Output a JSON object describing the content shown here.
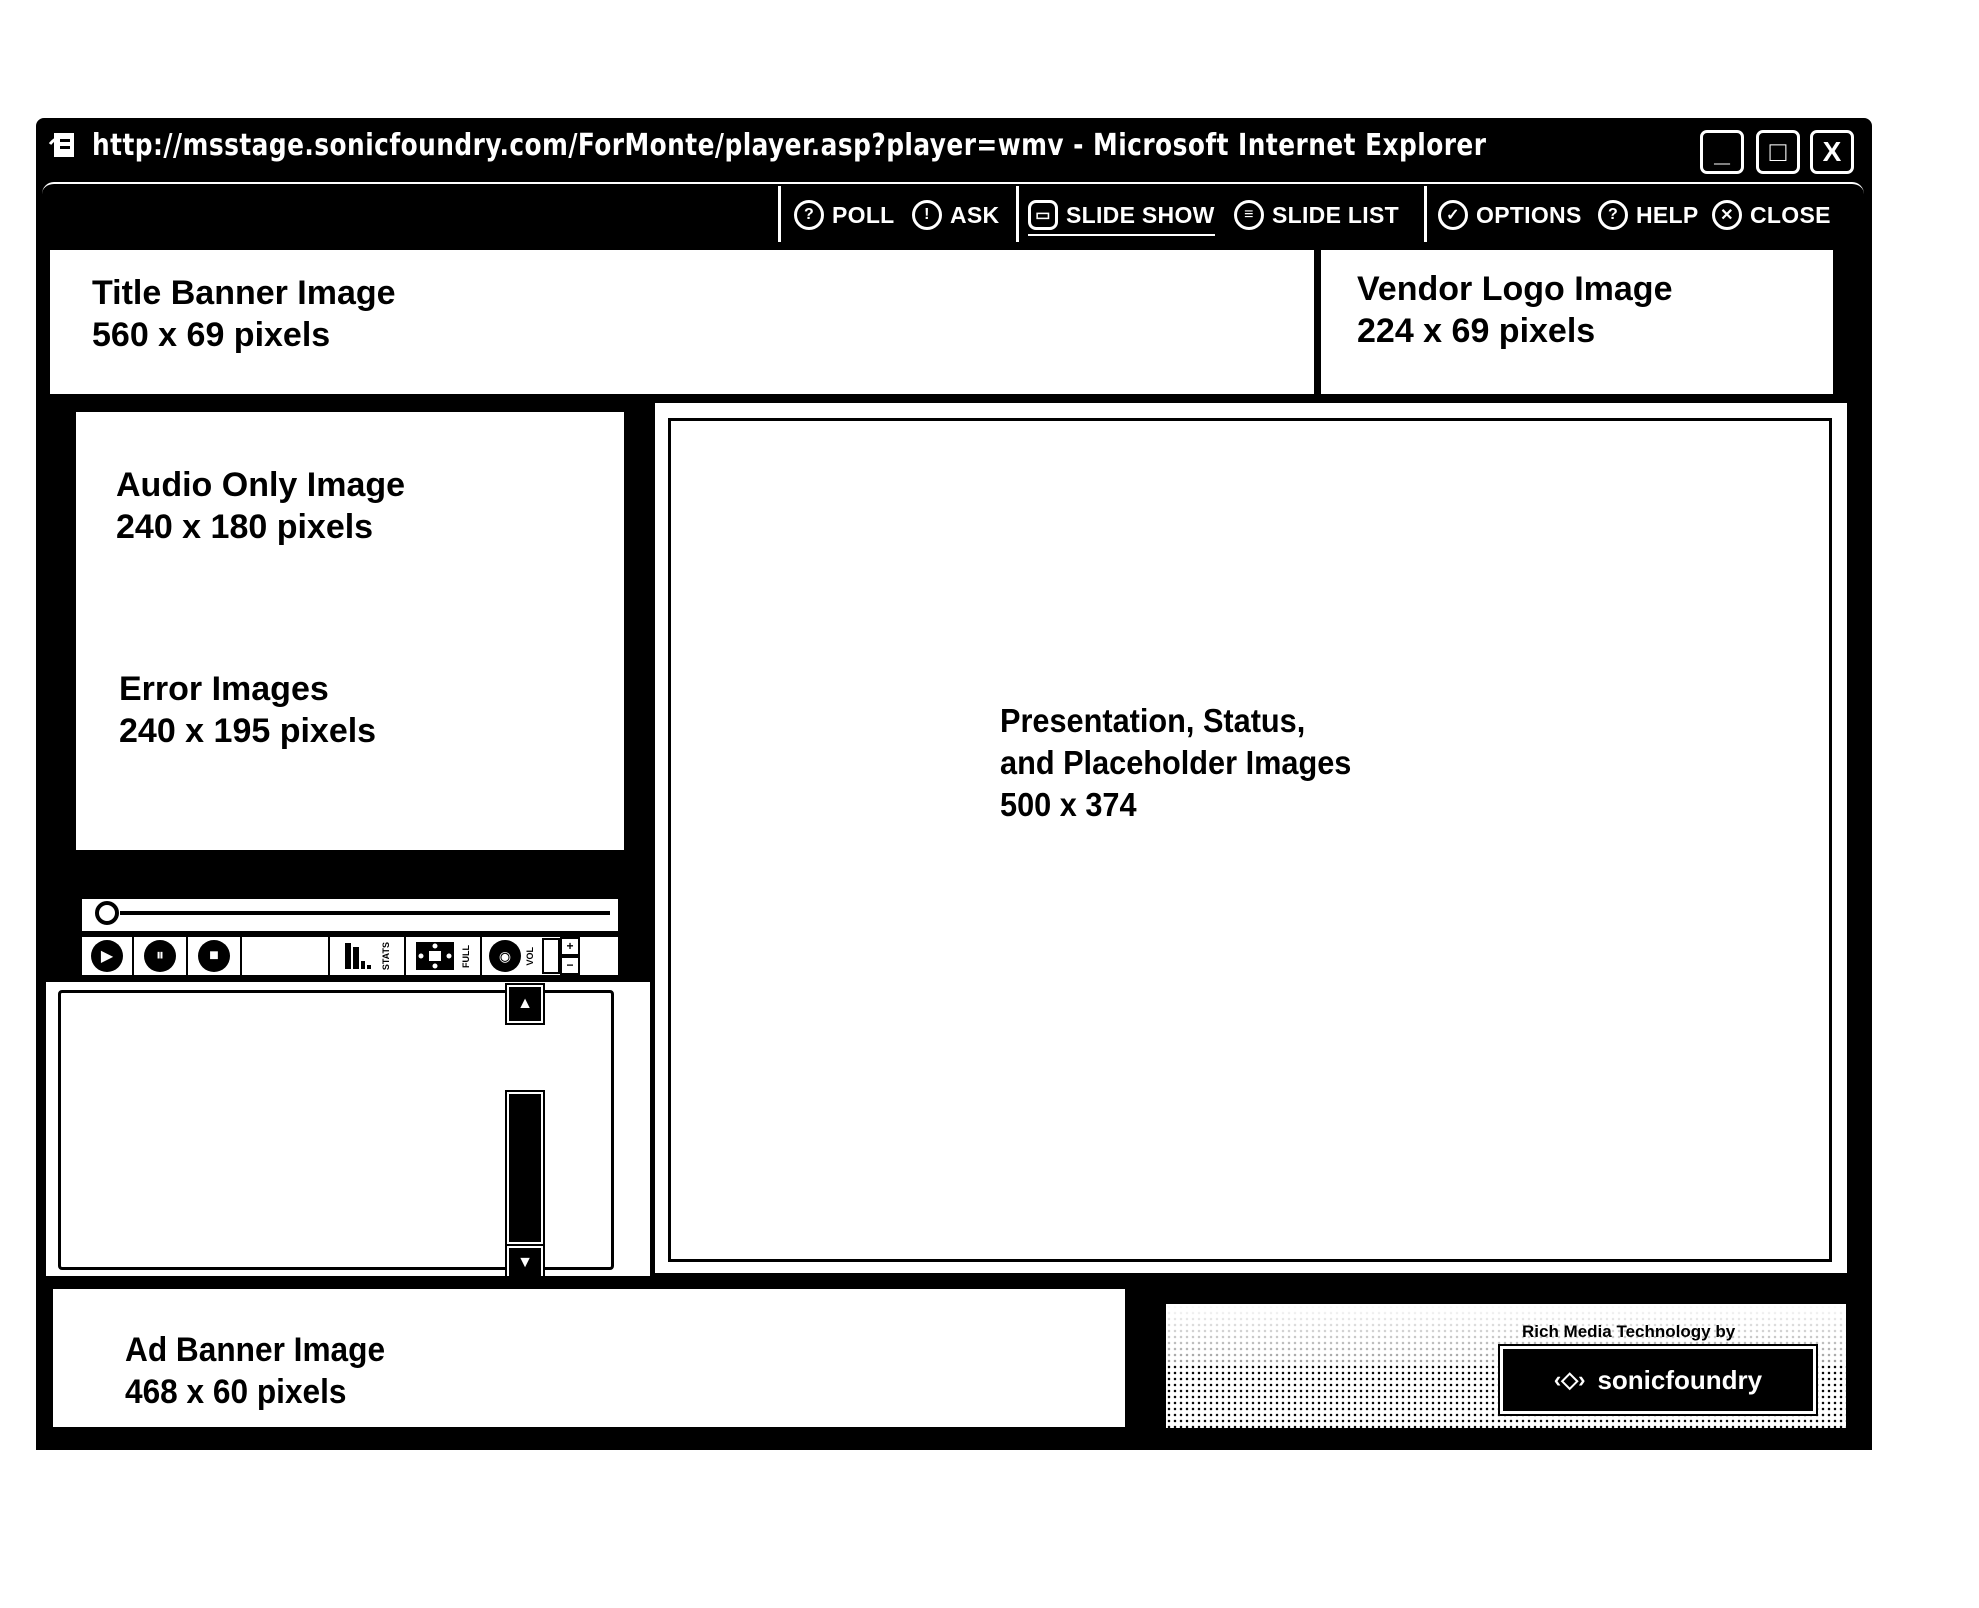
{
  "window": {
    "title": "http://msstage.sonicfoundry.com/ForMonte/player.asp?player=wmv - Microsoft Internet Explorer",
    "controls": {
      "minimize": "_",
      "maximize": "□",
      "close": "X"
    }
  },
  "toolbar": {
    "groups": [
      {
        "items": [
          {
            "label": "POLL",
            "icon": "poll-icon"
          },
          {
            "label": "ASK",
            "icon": "ask-icon"
          }
        ]
      },
      {
        "items": [
          {
            "label": "SLIDE SHOW",
            "icon": "slide-show-icon"
          },
          {
            "label": "SLIDE LIST",
            "icon": "slide-list-icon"
          }
        ]
      },
      {
        "items": [
          {
            "label": "OPTIONS",
            "icon": "options-icon"
          },
          {
            "label": "HELP",
            "icon": "help-icon"
          },
          {
            "label": "CLOSE",
            "icon": "close-icon"
          }
        ]
      }
    ]
  },
  "title_banner": {
    "name": "Title Banner Image",
    "size": "560 x 69 pixels"
  },
  "vendor_logo": {
    "name": "Vendor Logo Image",
    "size": "224 x 69 pixels"
  },
  "player": {
    "audio_only": {
      "name": "Audio Only Image",
      "size": "240 x 180 pixels"
    },
    "error": {
      "name": "Error Images",
      "size": "240 x 195 pixels"
    },
    "seek_position": 0,
    "controls": {
      "play": "▶",
      "pause": "⏸",
      "stop": "■",
      "stats_label": "STATS",
      "full_label": "FULL",
      "vol_label": "VOL",
      "vol_up": "+",
      "vol_down": "−"
    }
  },
  "presentation": {
    "line1": "Presentation, Status,",
    "line2": "and Placeholder Images",
    "size": "500 x 374"
  },
  "ad_banner": {
    "name": "Ad Banner Image",
    "size": "468 x 60 pixels"
  },
  "branding": {
    "caption": "Rich Media Technology by",
    "logo_text": "sonicfoundry"
  },
  "scrollbar": {
    "up": "▲",
    "down": "▼"
  }
}
